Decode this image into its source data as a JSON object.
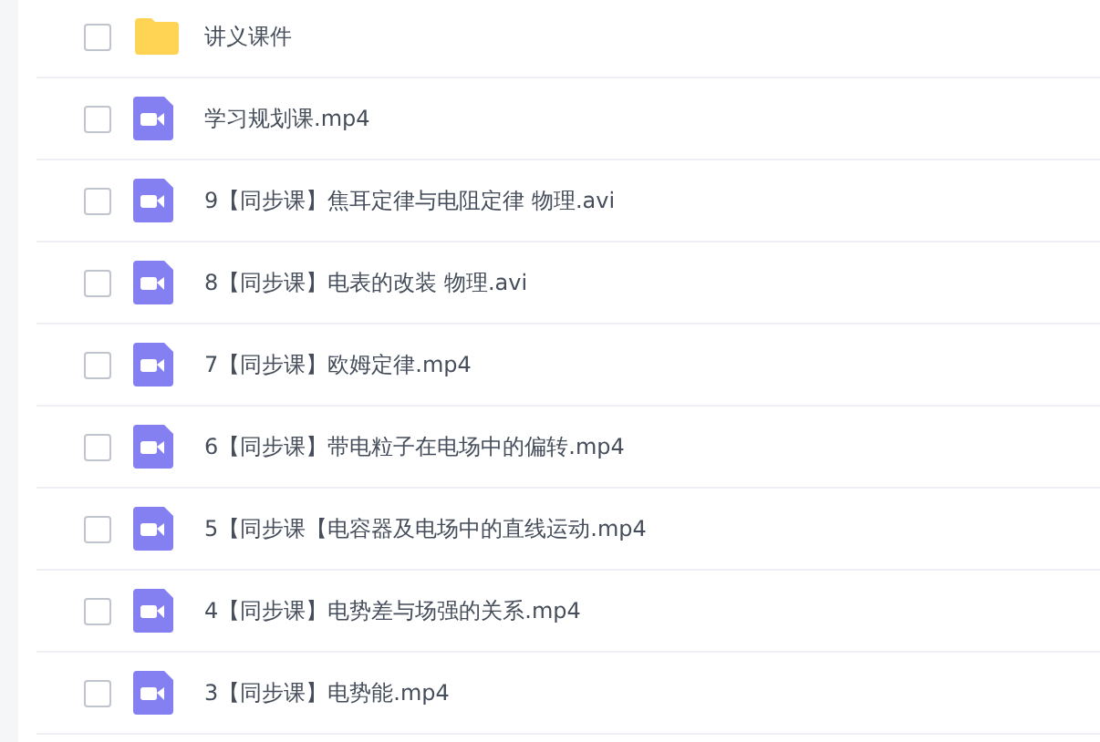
{
  "files": [
    {
      "kind": "folder",
      "name": "讲义课件",
      "checked": false
    },
    {
      "kind": "video",
      "name": "学习规划课.mp4",
      "checked": false
    },
    {
      "kind": "video",
      "name": "9【同步课】焦耳定律与电阻定律 物理.avi",
      "checked": false
    },
    {
      "kind": "video",
      "name": "8【同步课】电表的改装 物理.avi",
      "checked": false
    },
    {
      "kind": "video",
      "name": "7【同步课】欧姆定律.mp4",
      "checked": false
    },
    {
      "kind": "video",
      "name": "6【同步课】带电粒子在电场中的偏转.mp4",
      "checked": false
    },
    {
      "kind": "video",
      "name": "5【同步课【电容器及电场中的直线运动.mp4",
      "checked": false
    },
    {
      "kind": "video",
      "name": "4【同步课】电势差与场强的关系.mp4",
      "checked": false
    },
    {
      "kind": "video",
      "name": "3【同步课】电势能.mp4",
      "checked": false
    }
  ]
}
